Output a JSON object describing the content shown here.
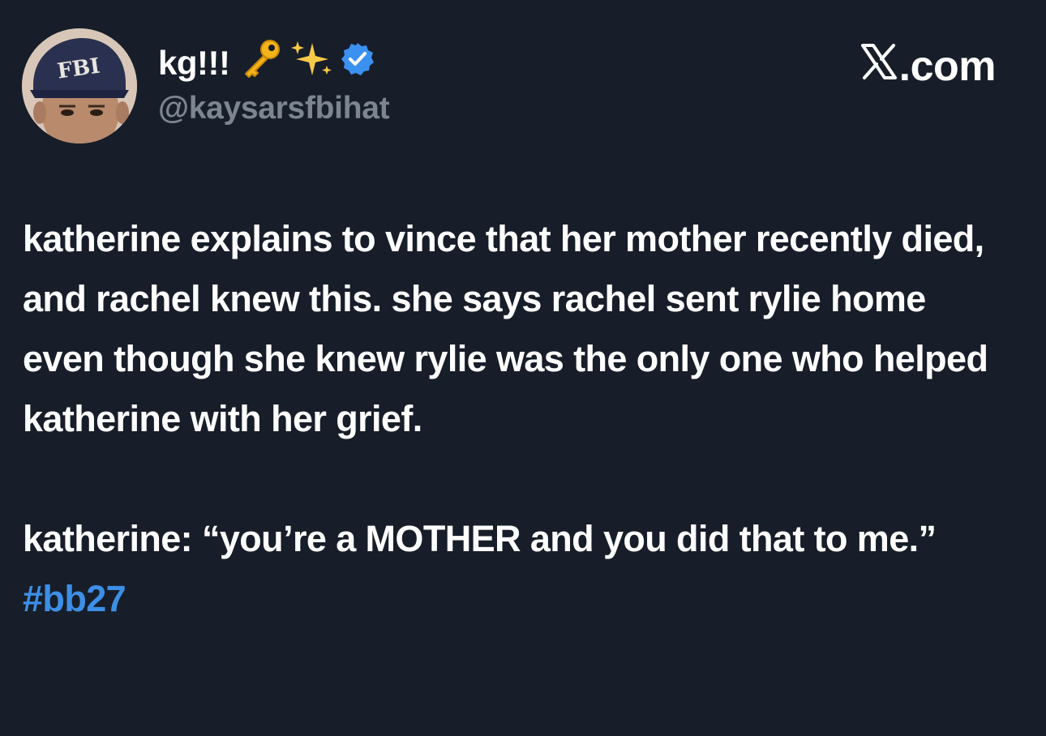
{
  "author": {
    "display_name": "kg!!!",
    "handle": "@kaysarsfbihat",
    "verified": true,
    "badge_color": "#3b91f0",
    "avatar_cap_text": "FBI",
    "emojis": [
      "key-emoji",
      "sparkles-emoji"
    ]
  },
  "brand": {
    "label": ".com",
    "logo": "x-logo-icon"
  },
  "tweet": {
    "paragraph_1": "katherine explains to vince that her mother recently died, and rachel knew this. she says rachel sent rylie home even though she knew rylie was the only one who helped katherine with her grief.",
    "paragraph_2_text": "katherine: “you’re a MOTHER and you did that to me.” ",
    "hashtag": "#bb27"
  },
  "colors": {
    "background": "#171e29",
    "text": "#ffffff",
    "handle": "#7c8590",
    "hashtag": "#3d8fe6"
  }
}
